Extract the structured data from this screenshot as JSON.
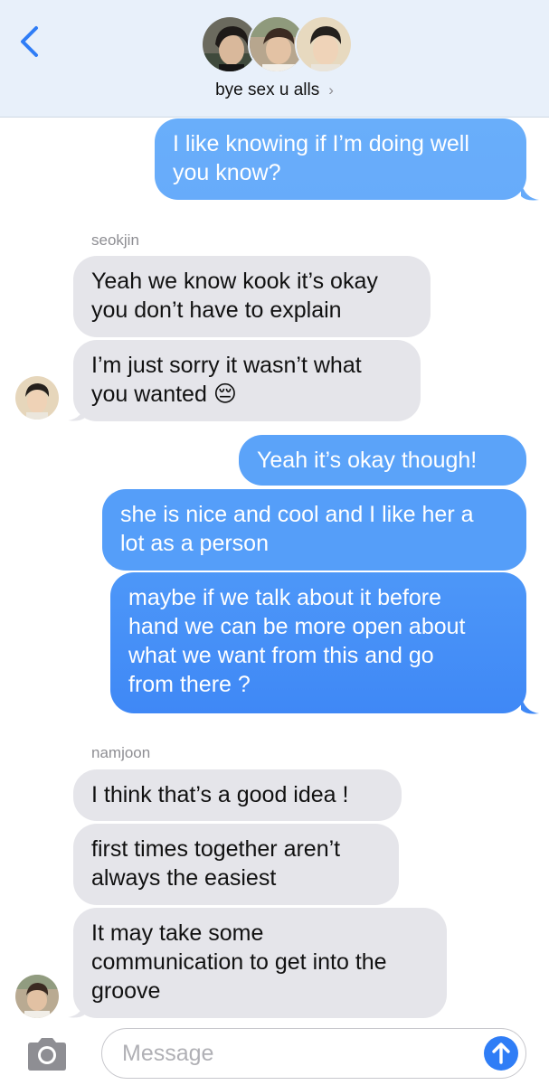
{
  "header": {
    "group_name": "bye sex u alls",
    "chevron": "›",
    "icons": {
      "back": "chevron-left-icon",
      "forward": "chevron-right-icon"
    }
  },
  "messages": [
    {
      "direction": "out",
      "text": "I like knowing if I’m doing well\nyou know?"
    },
    {
      "sender": "seokjin"
    },
    {
      "direction": "in",
      "text": "Yeah we know kook it’s okay\nyou don’t have to explain"
    },
    {
      "direction": "in",
      "text": "I’m just sorry it wasn’t what\nyou wanted 😔"
    },
    {
      "direction": "out",
      "text": "Yeah it’s okay though!"
    },
    {
      "direction": "out",
      "text": "she is nice and cool and I like her a\nlot as a person"
    },
    {
      "direction": "out",
      "text": "maybe if we talk about it before\nhand we can be more open about\nwhat we want from this and go\nfrom there ?"
    },
    {
      "sender": "namjoon"
    },
    {
      "direction": "in",
      "text": "I think that’s a good idea !"
    },
    {
      "direction": "in",
      "text": "first times together aren’t\nalways the easiest"
    },
    {
      "direction": "in",
      "text": "It may take some\ncommunication to get into the\ngroove"
    }
  ],
  "input": {
    "placeholder": "Message",
    "icons": {
      "camera": "camera-icon",
      "send": "arrow-up-icon"
    }
  },
  "colors": {
    "header_bg": "#e8f0fa",
    "incoming_bubble": "#e5e5ea",
    "outgoing_top": "#6eb2fb",
    "outgoing_bottom": "#3a83f5",
    "send_button": "#2f7df6",
    "back_chevron": "#2f7df6"
  }
}
